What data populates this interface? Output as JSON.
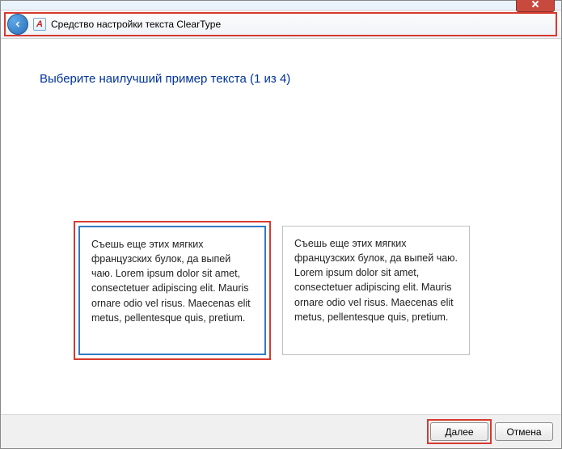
{
  "header": {
    "title": "Средство настройки текста ClearType",
    "app_icon_letter": "A"
  },
  "main": {
    "instruction": "Выберите наилучший пример текста (1 из 4)",
    "samples": [
      {
        "id": "sample-1",
        "selected": true,
        "annotated": true,
        "text": "Съешь еще этих мягких французских булок, да выпей чаю. Lorem ipsum dolor sit amet, consectetuer adipiscing elit. Mauris ornare odio vel risus. Maecenas elit metus, pellentesque quis, pretium."
      },
      {
        "id": "sample-2",
        "selected": false,
        "annotated": false,
        "text": "Съешь еще этих мягких французских булок, да выпей чаю. Lorem ipsum dolor sit amet, consectetuer adipiscing elit. Mauris ornare odio vel risus. Maecenas elit metus, pellentesque quis, pretium."
      }
    ]
  },
  "footer": {
    "next_label": "Далее",
    "cancel_label": "Отмена",
    "next_annotated": true
  }
}
